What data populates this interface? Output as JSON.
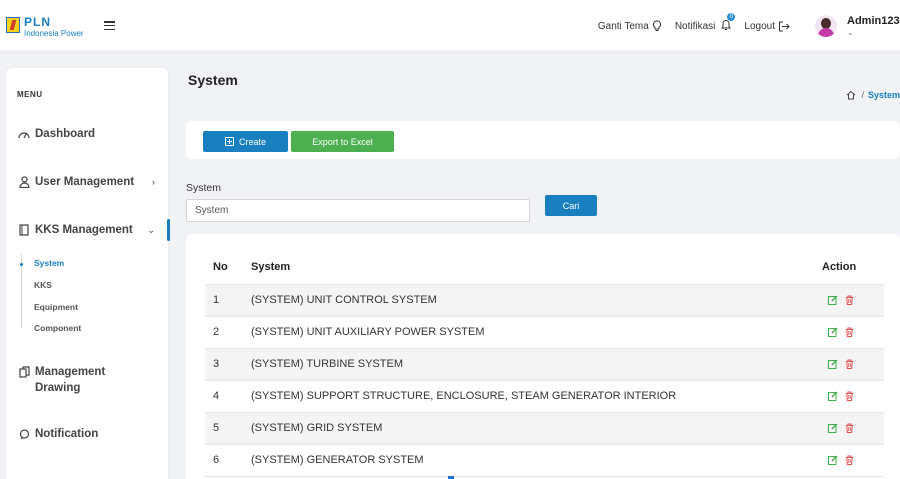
{
  "header": {
    "logo_name": "PLN",
    "logo_sub": "Indonesia Power",
    "theme_label": "Ganti Tema",
    "notif_label": "Notifikasi",
    "notif_count": "0",
    "logout_label": "Logout",
    "user_name": "Admin123"
  },
  "sidebar": {
    "menu_title": "MENU",
    "items": [
      {
        "label": "Dashboard",
        "icon": "dashboard-gauge-icon"
      },
      {
        "label": "User Management",
        "icon": "user-icon"
      },
      {
        "label": "KKS Management",
        "icon": "book-icon"
      },
      {
        "label": "Management Drawing",
        "icon": "copy-icon"
      },
      {
        "label": "Notification",
        "icon": "chat-icon"
      }
    ],
    "sub_items": [
      "System",
      "KKS",
      "Equipment",
      "Component"
    ]
  },
  "page": {
    "title": "System",
    "breadcrumb_current": "System"
  },
  "toolbar": {
    "create_label": "Create",
    "excel_label": "Export to Excel"
  },
  "filter": {
    "label": "System",
    "value": "System",
    "search_label": "Cari"
  },
  "table": {
    "headers": [
      "No",
      "System",
      "Action"
    ],
    "rows": [
      {
        "no": "1",
        "system": "(SYSTEM) UNIT CONTROL SYSTEM"
      },
      {
        "no": "2",
        "system": "(SYSTEM) UNIT AUXILIARY POWER SYSTEM"
      },
      {
        "no": "3",
        "system": "(SYSTEM) TURBINE SYSTEM"
      },
      {
        "no": "4",
        "system": "(SYSTEM) SUPPORT STRUCTURE, ENCLOSURE, STEAM GENERATOR INTERIOR"
      },
      {
        "no": "5",
        "system": "(SYSTEM) GRID SYSTEM"
      },
      {
        "no": "6",
        "system": "(SYSTEM) GENERATOR SYSTEM"
      }
    ]
  },
  "colors": {
    "primary": "#1a7fbf",
    "excel": "#4caf50",
    "edit": "#3cb04b",
    "delete": "#e05050"
  }
}
